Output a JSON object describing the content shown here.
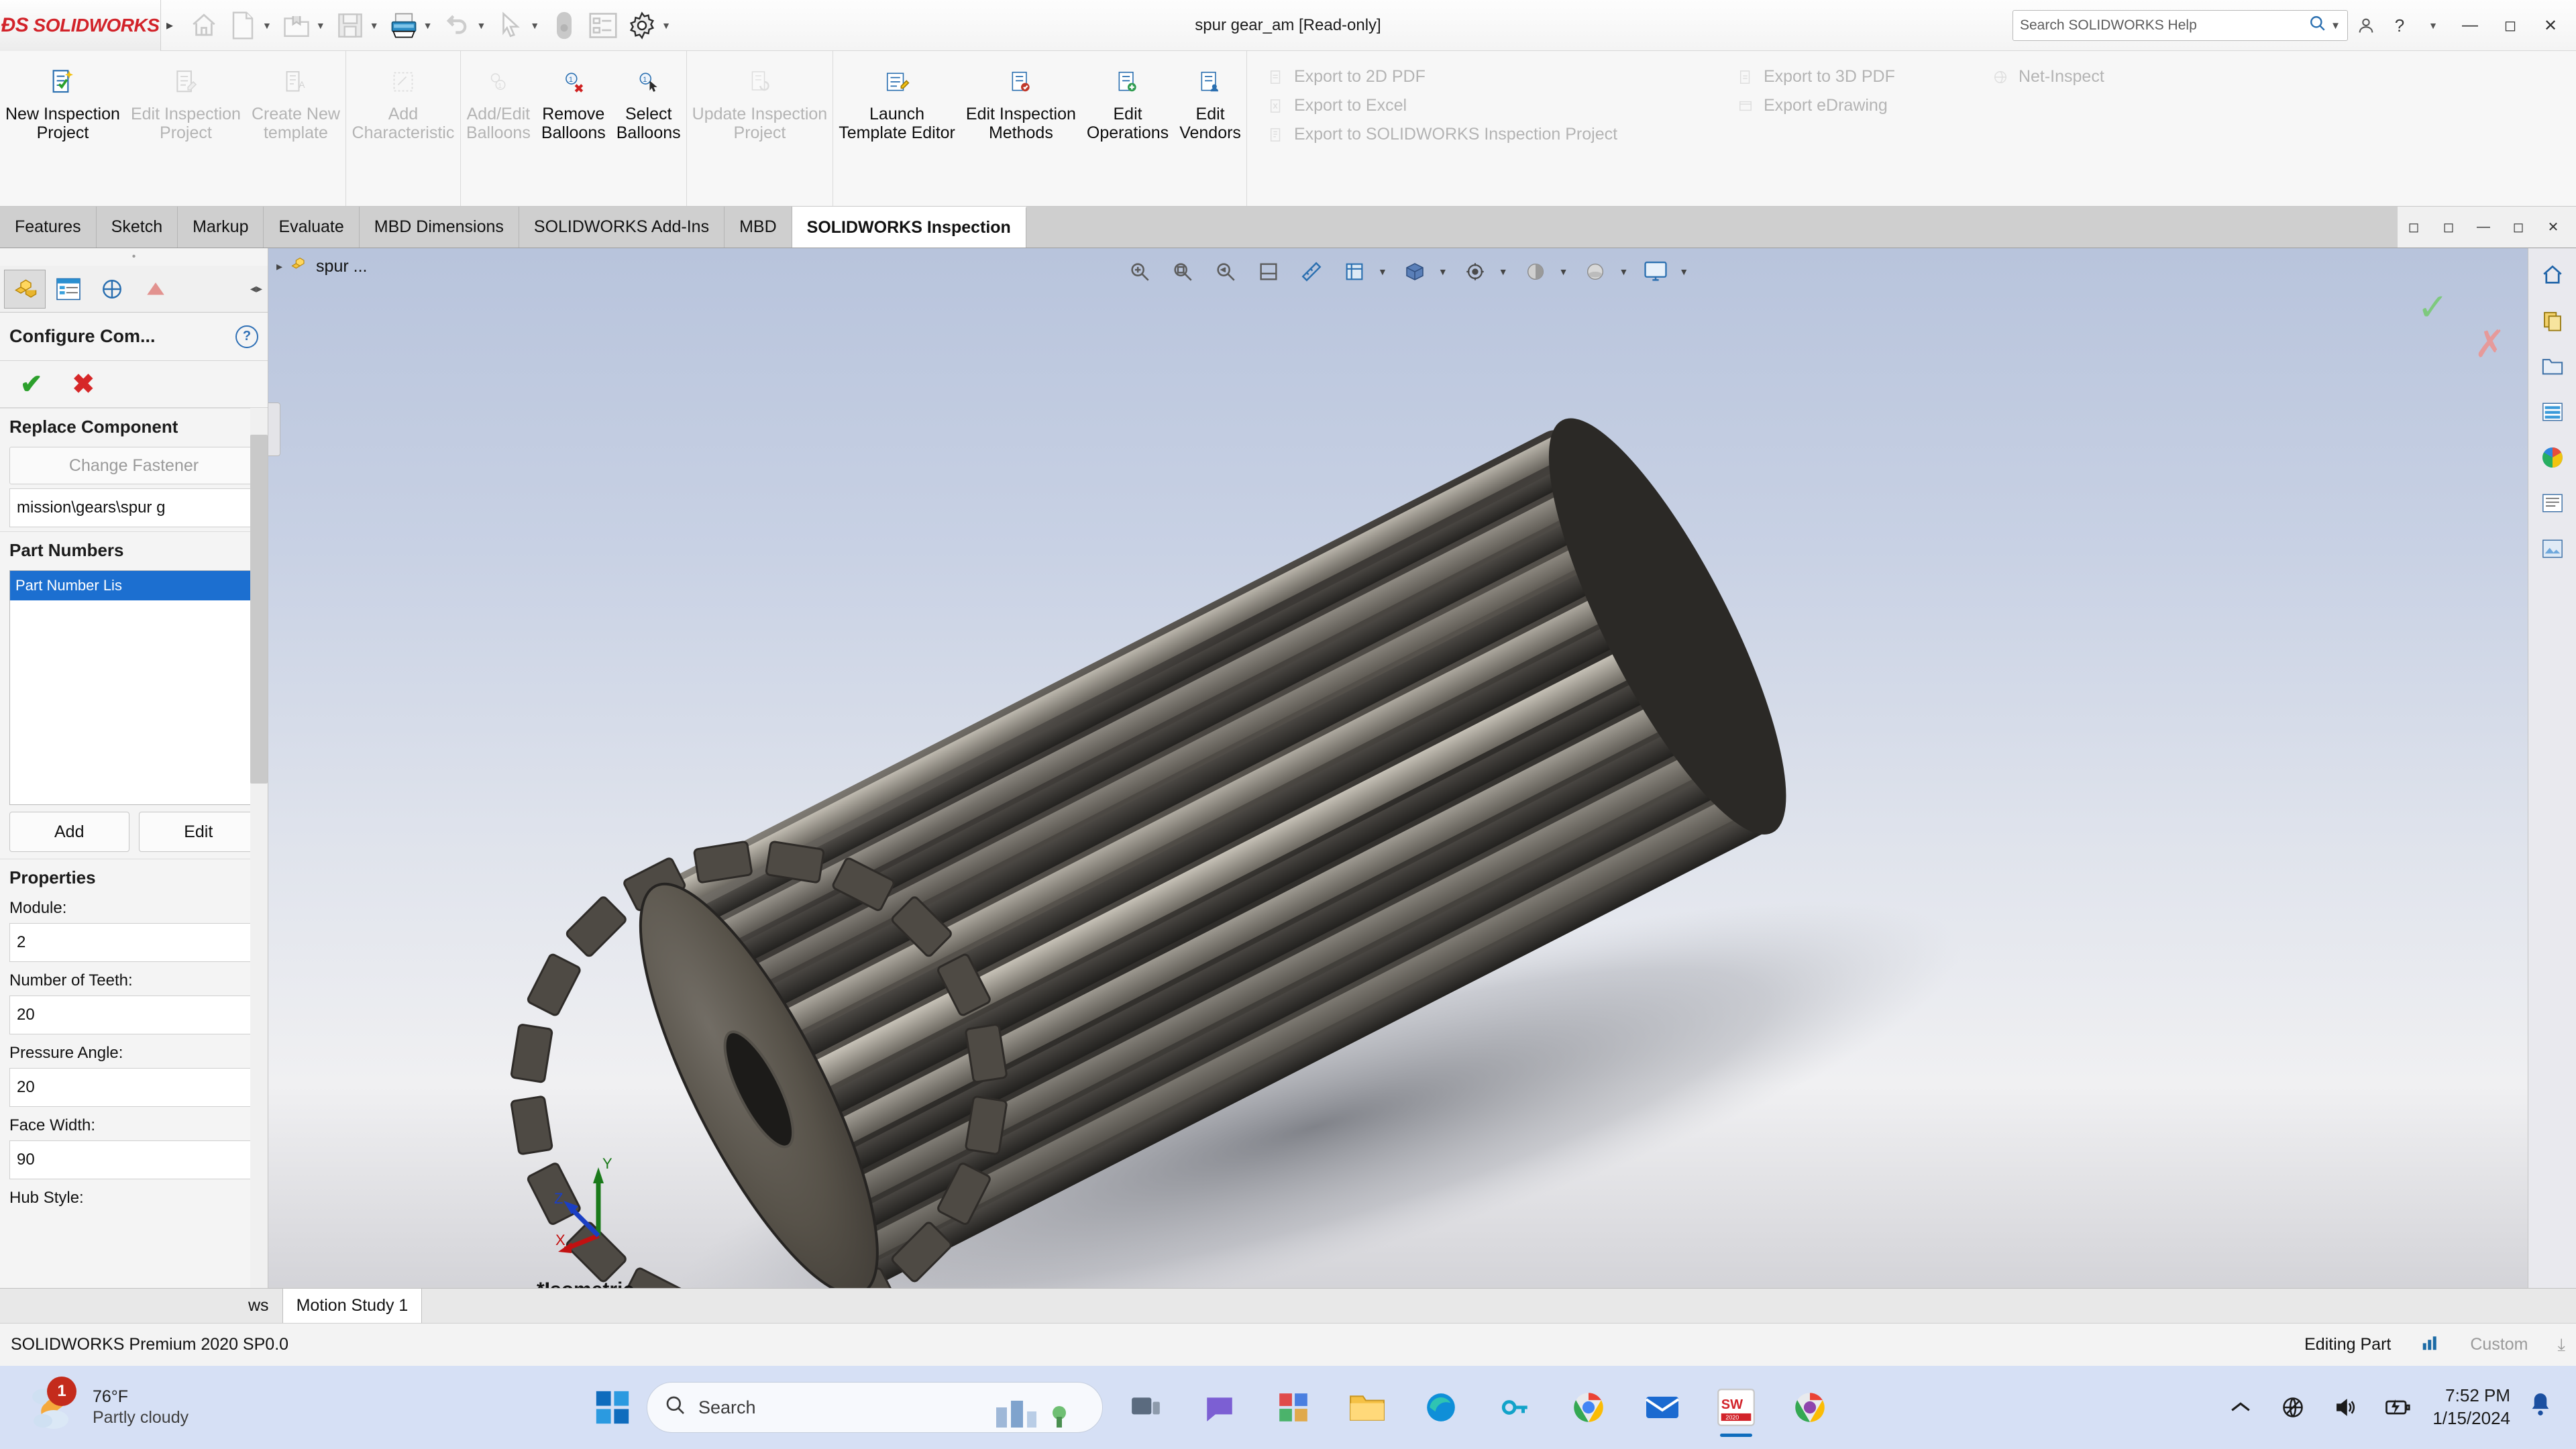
{
  "titlebar": {
    "logo": "SOLIDWORKS",
    "logo_prefix": "DS",
    "document_title": "spur gear_am [Read-only]",
    "search_placeholder": "Search SOLIDWORKS Help",
    "quick_access": [
      {
        "name": "home-icon",
        "label": "Home"
      },
      {
        "name": "new-document-icon",
        "label": "New"
      },
      {
        "name": "open-folder-icon",
        "label": "Open"
      },
      {
        "name": "save-icon",
        "label": "Save"
      },
      {
        "name": "print-icon",
        "label": "Print"
      },
      {
        "name": "undo-icon",
        "label": "Undo"
      },
      {
        "name": "select-cursor-icon",
        "label": "Select"
      },
      {
        "name": "measure-icon",
        "label": "Measure"
      },
      {
        "name": "options-list-icon",
        "label": "Options"
      },
      {
        "name": "gear-icon",
        "label": "Settings"
      }
    ],
    "window_controls": {
      "minimize": "—",
      "maximize": "❐",
      "close": "✕"
    },
    "user_icon": "user-account-icon",
    "help_icon": "help-icon"
  },
  "ribbon": {
    "groups": [
      {
        "name": "project-group",
        "buttons": [
          {
            "label": "New Inspection\nProject",
            "disabled": false,
            "icon": "new-inspection-project-icon"
          },
          {
            "label": "Edit Inspection\nProject",
            "disabled": true,
            "icon": "edit-inspection-project-icon"
          },
          {
            "label": "Create New\ntemplate",
            "disabled": true,
            "icon": "create-template-icon"
          }
        ]
      },
      {
        "name": "characteristic-group",
        "buttons": [
          {
            "label": "Add\nCharacteristic",
            "disabled": true,
            "icon": "add-characteristic-icon"
          }
        ]
      },
      {
        "name": "balloons-group",
        "buttons": [
          {
            "label": "Add/Edit\nBalloons",
            "disabled": true,
            "icon": "add-edit-balloons-icon"
          },
          {
            "label": "Remove\nBalloons",
            "disabled": false,
            "icon": "remove-balloons-icon"
          },
          {
            "label": "Select\nBalloons",
            "disabled": false,
            "icon": "select-balloons-icon"
          }
        ]
      },
      {
        "name": "update-group",
        "buttons": [
          {
            "label": "Update Inspection\nProject",
            "disabled": true,
            "icon": "update-inspection-project-icon"
          }
        ]
      },
      {
        "name": "editors-group",
        "buttons": [
          {
            "label": "Launch\nTemplate Editor",
            "disabled": false,
            "icon": "launch-template-editor-icon"
          },
          {
            "label": "Edit Inspection\nMethods",
            "disabled": false,
            "icon": "edit-inspection-methods-icon"
          },
          {
            "label": "Edit\nOperations",
            "disabled": false,
            "icon": "edit-operations-icon"
          },
          {
            "label": "Edit\nVendors",
            "disabled": false,
            "icon": "edit-vendors-icon"
          }
        ]
      }
    ],
    "export_column_1": [
      {
        "label": "Export to 2D PDF",
        "disabled": true,
        "icon": "export-2d-pdf-icon"
      },
      {
        "label": "Export to Excel",
        "disabled": true,
        "icon": "export-excel-icon"
      },
      {
        "label": "Export to SOLIDWORKS Inspection Project",
        "disabled": true,
        "icon": "export-sw-inspection-icon"
      }
    ],
    "export_column_2": [
      {
        "label": "Export to 3D PDF",
        "disabled": true,
        "icon": "export-3d-pdf-icon"
      },
      {
        "label": "Export eDrawing",
        "disabled": true,
        "icon": "export-edrawing-icon"
      }
    ],
    "export_column_3": [
      {
        "label": "Net-Inspect",
        "disabled": true,
        "icon": "net-inspect-icon"
      }
    ]
  },
  "command_tabs": {
    "tabs": [
      {
        "label": "Features",
        "active": false
      },
      {
        "label": "Sketch",
        "active": false
      },
      {
        "label": "Markup",
        "active": false
      },
      {
        "label": "Evaluate",
        "active": false
      },
      {
        "label": "MBD Dimensions",
        "active": false
      },
      {
        "label": "SOLIDWORKS Add-Ins",
        "active": false
      },
      {
        "label": "MBD",
        "active": false
      },
      {
        "label": "SOLIDWORKS Inspection",
        "active": true
      }
    ],
    "window_controls": {
      "restore_small": "❐",
      "restore": "❐",
      "minimize": "—",
      "maximize": "❐",
      "close": "✕"
    }
  },
  "left_panel": {
    "tabs": [
      {
        "name": "feature-manager-tab",
        "icon": "feature-tree-icon",
        "active": true
      },
      {
        "name": "property-manager-tab",
        "icon": "property-manager-icon",
        "active": false
      },
      {
        "name": "configuration-manager-tab",
        "icon": "configuration-icon",
        "active": false
      },
      {
        "name": "dimxpert-manager-tab",
        "icon": "dimxpert-icon",
        "active": false
      },
      {
        "name": "display-manager-tab",
        "icon": "display-manager-icon",
        "active": false
      }
    ],
    "title": "Configure Com...",
    "ok_label": "✔",
    "cancel_label": "✖",
    "sections": {
      "replace_component": {
        "heading": "Replace Component",
        "change_fastener_button": "Change Fastener",
        "path_value": "mission\\gears\\spur g"
      },
      "part_numbers": {
        "heading": "Part Numbers",
        "list_header": "Part Number Lis",
        "add_button": "Add",
        "edit_button": "Edit"
      },
      "properties": {
        "heading": "Properties",
        "fields": [
          {
            "label": "Module:",
            "value": "2"
          },
          {
            "label": "Number of Teeth:",
            "value": "20"
          },
          {
            "label": "Pressure Angle:",
            "value": "20"
          },
          {
            "label": "Face Width:",
            "value": "90"
          },
          {
            "label": "Hub Style:",
            "value": ""
          }
        ]
      }
    }
  },
  "viewport": {
    "tree_item": "spur ...",
    "view_name": "*Isometric",
    "triad": {
      "x": "X",
      "y": "Y",
      "z": "Z"
    },
    "toolbar": [
      {
        "name": "zoom-to-fit-icon"
      },
      {
        "name": "zoom-to-area-icon"
      },
      {
        "name": "previous-view-icon"
      },
      {
        "name": "section-view-icon"
      },
      {
        "name": "view-orientation-icon"
      },
      {
        "name": "display-style-icon"
      },
      {
        "name": "hide-show-icon"
      },
      {
        "name": "edit-appearance-icon"
      },
      {
        "name": "apply-scene-icon"
      },
      {
        "name": "view-settings-icon"
      }
    ],
    "right_toolbar": [
      {
        "name": "home-view-icon"
      },
      {
        "name": "copy-icon"
      },
      {
        "name": "folder-icon"
      },
      {
        "name": "appearances-icon"
      },
      {
        "name": "color-wheel-icon"
      },
      {
        "name": "scenes-icon"
      },
      {
        "name": "decals-icon"
      }
    ]
  },
  "bottom_tabs": [
    {
      "label": "ws",
      "active": false
    },
    {
      "label": "Motion Study 1",
      "active": true
    }
  ],
  "statusbar": {
    "version": "SOLIDWORKS Premium 2020 SP0.0",
    "editing": "Editing Part",
    "units": "Custom",
    "chart_icon": "chart-icon",
    "expand_icon": "chevron-expand-icon"
  },
  "taskbar": {
    "weather": {
      "temperature": "76°F",
      "condition": "Partly cloudy",
      "badge": "1"
    },
    "search_placeholder": "Search",
    "apps": [
      {
        "name": "task-view-icon"
      },
      {
        "name": "chat-icon"
      },
      {
        "name": "widgets-icon"
      },
      {
        "name": "file-explorer-icon"
      },
      {
        "name": "edge-browser-icon"
      },
      {
        "name": "vpn-key-icon"
      },
      {
        "name": "chrome-browser-icon"
      },
      {
        "name": "mail-icon"
      },
      {
        "name": "solidworks-app-icon"
      },
      {
        "name": "chrome-secondary-icon"
      }
    ],
    "system": {
      "chevron": "⌃",
      "network": "network-offline-icon",
      "volume": "volume-icon",
      "battery": "battery-charging-icon",
      "time": "7:52 PM",
      "date": "1/15/2024",
      "bell": "notification-bell-icon"
    }
  },
  "colors": {
    "brand_red": "#d2232a",
    "accent_blue": "#1c6fd0",
    "ok_green": "#2ca02c",
    "cancel_red": "#d62728",
    "taskbar_bg": "#d6e0f5"
  }
}
